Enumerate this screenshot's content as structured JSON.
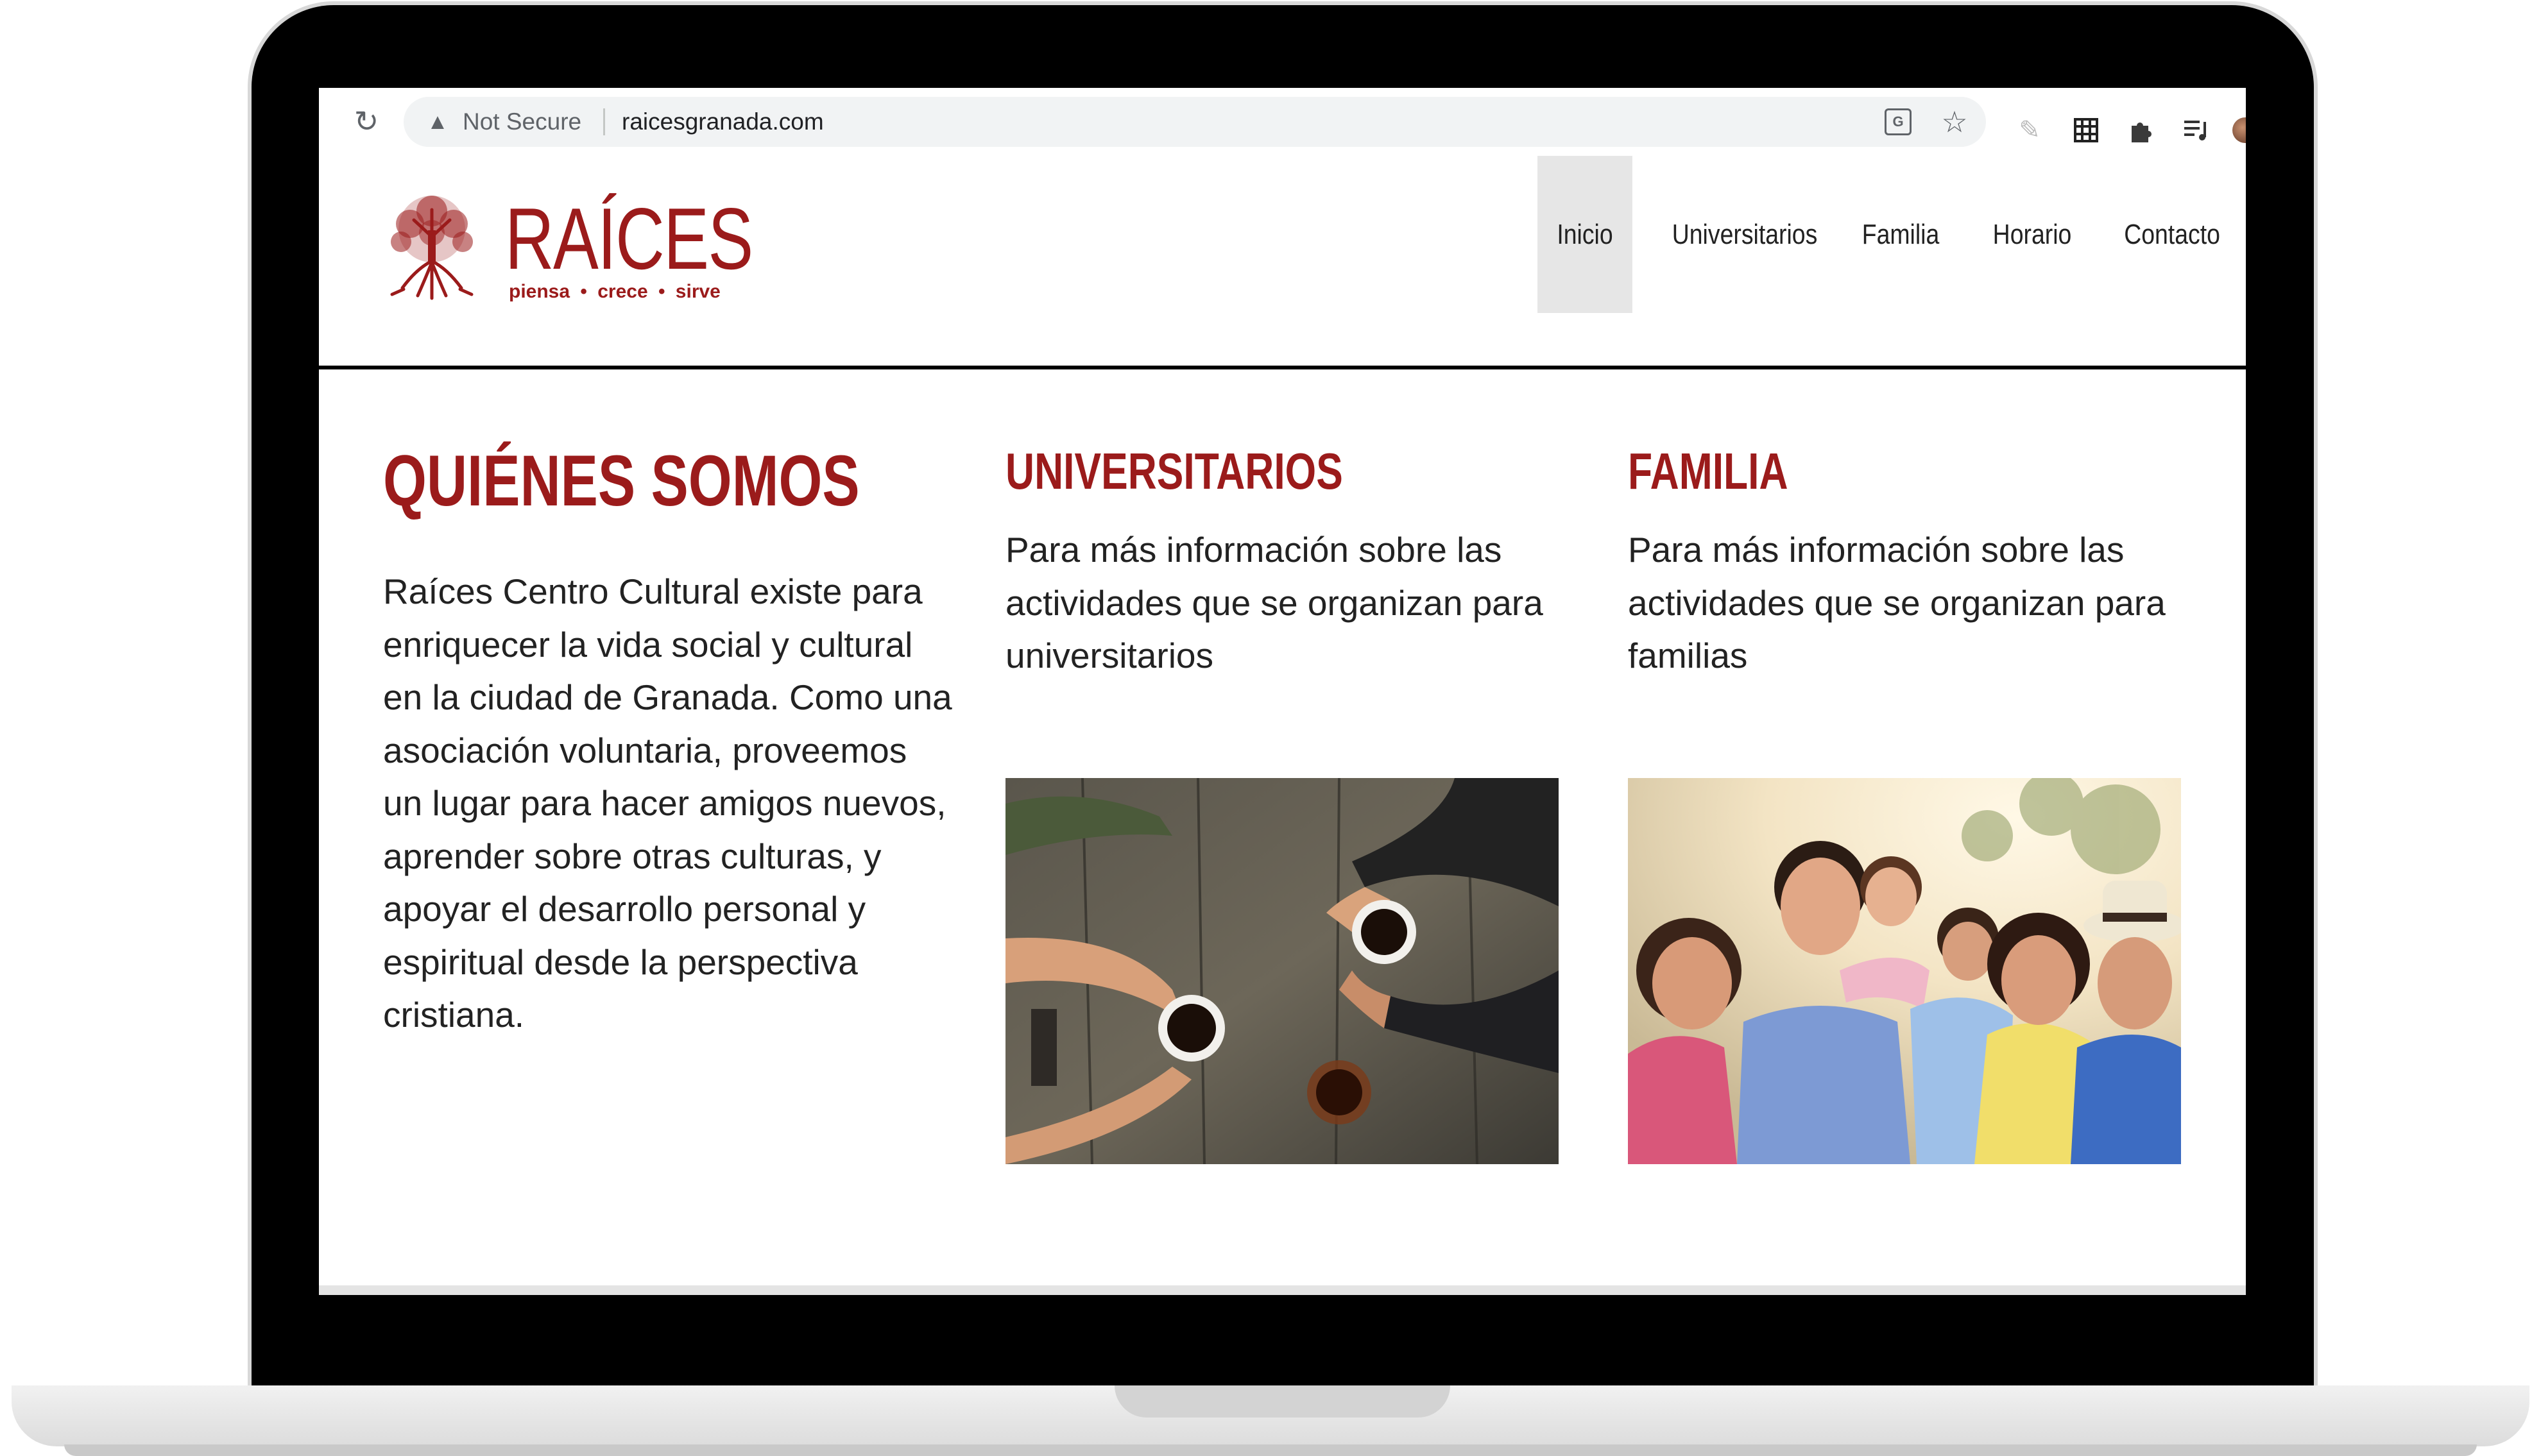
{
  "browser": {
    "security_label": "Not Secure",
    "url": "raicesgranada.com"
  },
  "site": {
    "logo": {
      "name": "RAÍCES",
      "tagline": "piensa  •  crece  •  sirve",
      "brand_color": "#9b1b1b"
    },
    "nav": {
      "items": [
        {
          "label": "Inicio",
          "active": true
        },
        {
          "label": "Universitarios",
          "active": false
        },
        {
          "label": "Familia",
          "active": false
        },
        {
          "label": "Horario",
          "active": false
        },
        {
          "label": "Contacto",
          "active": false
        }
      ]
    }
  },
  "main": {
    "about": {
      "title": "QUIÉNES SOMOS",
      "lines": [
        "Raíces Centro Cultural existe para",
        "enriquecer la vida social y cultural",
        "en la ciudad de Granada. Como una",
        "asociación voluntaria, proveemos",
        "un lugar para hacer amigos nuevos,",
        "aprender sobre otras culturas, y",
        "apoyar el desarrollo personal y",
        "espiritual desde la perspectiva",
        "cristiana."
      ]
    },
    "universitarios": {
      "title": "UNIVERSITARIOS",
      "lines": [
        "Para más información sobre las",
        "actividades que se organizan para",
        "universitarios"
      ]
    },
    "familia": {
      "title": "FAMILIA",
      "lines": [
        "Para más información sobre las",
        "actividades que se organizan para",
        "familias"
      ]
    }
  }
}
